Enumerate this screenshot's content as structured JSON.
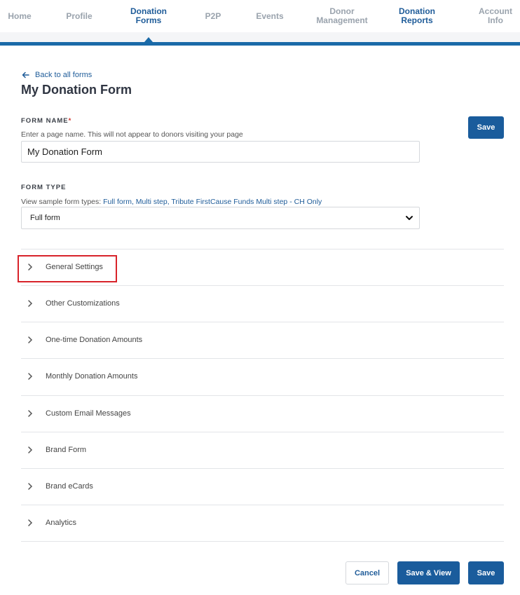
{
  "nav": {
    "items": [
      {
        "label": "Home"
      },
      {
        "label": "Profile"
      },
      {
        "label": "Donation Forms"
      },
      {
        "label": "P2P"
      },
      {
        "label": "Events"
      },
      {
        "label": "Donor Management"
      },
      {
        "label": "Donation Reports"
      },
      {
        "label": "Account Info"
      }
    ],
    "active_index": 2
  },
  "back_link": "Back to all forms",
  "page_title": "My Donation Form",
  "form_name": {
    "label": "FORM NAME",
    "required_mark": "*",
    "hint": "Enter a page name. This will not appear to donors visiting your page",
    "value": "My Donation Form"
  },
  "form_type": {
    "label": "FORM TYPE",
    "hint_prefix": "View sample form types: ",
    "hint_links": "Full form, Multi step, Tribute FirstCause Funds Multi step - CH Only",
    "selected": "Full form"
  },
  "save_top": "Save",
  "sections": [
    {
      "label": "General Settings"
    },
    {
      "label": "Other Customizations"
    },
    {
      "label": "One-time Donation Amounts"
    },
    {
      "label": "Monthly Donation Amounts"
    },
    {
      "label": "Custom Email Messages"
    },
    {
      "label": "Brand Form"
    },
    {
      "label": "Brand eCards"
    },
    {
      "label": "Analytics"
    }
  ],
  "footer": {
    "cancel": "Cancel",
    "save_view": "Save & View",
    "save": "Save"
  },
  "colors": {
    "accent": "#1a5c9c",
    "nav_line": "#1a6aa8",
    "highlight": "#d8232a"
  }
}
